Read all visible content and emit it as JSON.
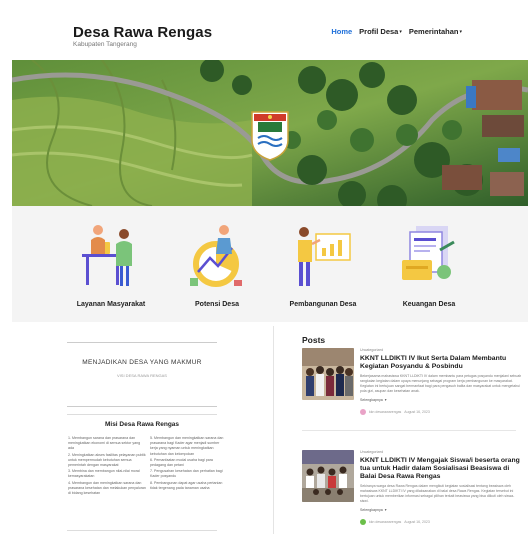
{
  "header": {
    "site_title": "Desa Rawa Rengas",
    "site_subtitle": "Kabupaten Tangerang",
    "nav": [
      {
        "label": "Home",
        "active": true,
        "has_dropdown": false
      },
      {
        "label": "Profil Desa",
        "active": false,
        "has_dropdown": true
      },
      {
        "label": "Pemerintahan",
        "active": false,
        "has_dropdown": true
      }
    ],
    "dropdown_glyph": "▾"
  },
  "hero": {
    "emblem_icon": "village-emblem-icon"
  },
  "services": [
    {
      "label": "Layanan Masyarakat",
      "icon": "community-service-illustration-icon"
    },
    {
      "label": "Potensi Desa",
      "icon": "village-potential-illustration-icon"
    },
    {
      "label": "Pembangunan Desa",
      "icon": "village-development-illustration-icon"
    },
    {
      "label": "Keuangan Desa",
      "icon": "village-finance-illustration-icon"
    }
  ],
  "vision": {
    "title": "MENJADIKAN DESA YANG MAKMUR",
    "subtitle": "VISI DESA RAWA RENGAS"
  },
  "mission": {
    "title": "Misi Desa Rawa Rengas",
    "left_items": [
      "1. Membangun sarana dan prasarana dan meningkatkan ekonomi di semua sektor yang ada",
      "2. Meningkatkan akses fasilitas pelayanan publik untuk mempermudah kebutuhan semua pemerintah dengan masyarakat",
      "3. Membina dan membangun nilai-nilai moral kemasyarakatan",
      "4. Membangun dan meningkatkan sarana dan prasarana kesehatan dan melakukan penyaluran di bidang kesehatan"
    ],
    "right_items": [
      "5. Membangun dan meningkatkan sarana dan prasarana bagi Kader agar menjadi sumber kerja yang nyaman untuk meningkatkan kebutuhan dan kelompokan",
      "6. Pemanfaatan modal usaha bagi para pedagang dan petani",
      "7. Pengusahan kesehatan dan perhatian bagi Kader posyandu",
      "8. Pembangunan dapat agar usaha pertanian tidak tergenang pada tanaman usaha"
    ]
  },
  "posts": {
    "title": "Posts",
    "items": [
      {
        "category": "Uncategorized",
        "title": "KKNT LLDIKTI IV Ikut Serta Dalam Membantu Kegiatan Posyandu & Posbindu",
        "excerpt": "Bekerjasama mahasiswa KKNT LLDIKTI IV dalam membantu para petugas posyandu menjalani sebuah rangkaian kegiatan dalam upaya menunjang sebagai program kerja pembangunan ke masyarakat. Kegiatan ini bertujuan sangat bermanfaat bagi para pengasuh balita dan masyarakat untuk mengetahui pola gizi, asupan dan kesehatan anak.",
        "more": "Selengkapnya",
        "author": "kkn desarawarengas",
        "date": "August 16, 2023"
      },
      {
        "category": "Uncategorized",
        "title": "KKNT LLDIKTI IV Mengajak Siswa/i beserta orang tua untuk Hadir dalam Sosialisasi Beasiswa di Balai Desa Rawa Rengas",
        "excerpt": "Sekiranya warga desa Rawa Rengas dalam mengikuti kegiatan sosialisasi tentang beasiswa oleh mahasiswa KKNT LLDIKTI IV yang dilaksanakan di balai desa Rawa Rengas. Kegiatan tersebut ini bertujuan untuk memberikan informasi sebagai pilihan terkait beasiswa yang bisa diikuti oleh siswa-siswi.",
        "more": "Selengkapnya",
        "author": "kkn desarawarengas",
        "date": "August 16, 2023"
      }
    ]
  },
  "colors": {
    "accent": "#1e6fd9",
    "services_bg": "#f4f4f4"
  }
}
